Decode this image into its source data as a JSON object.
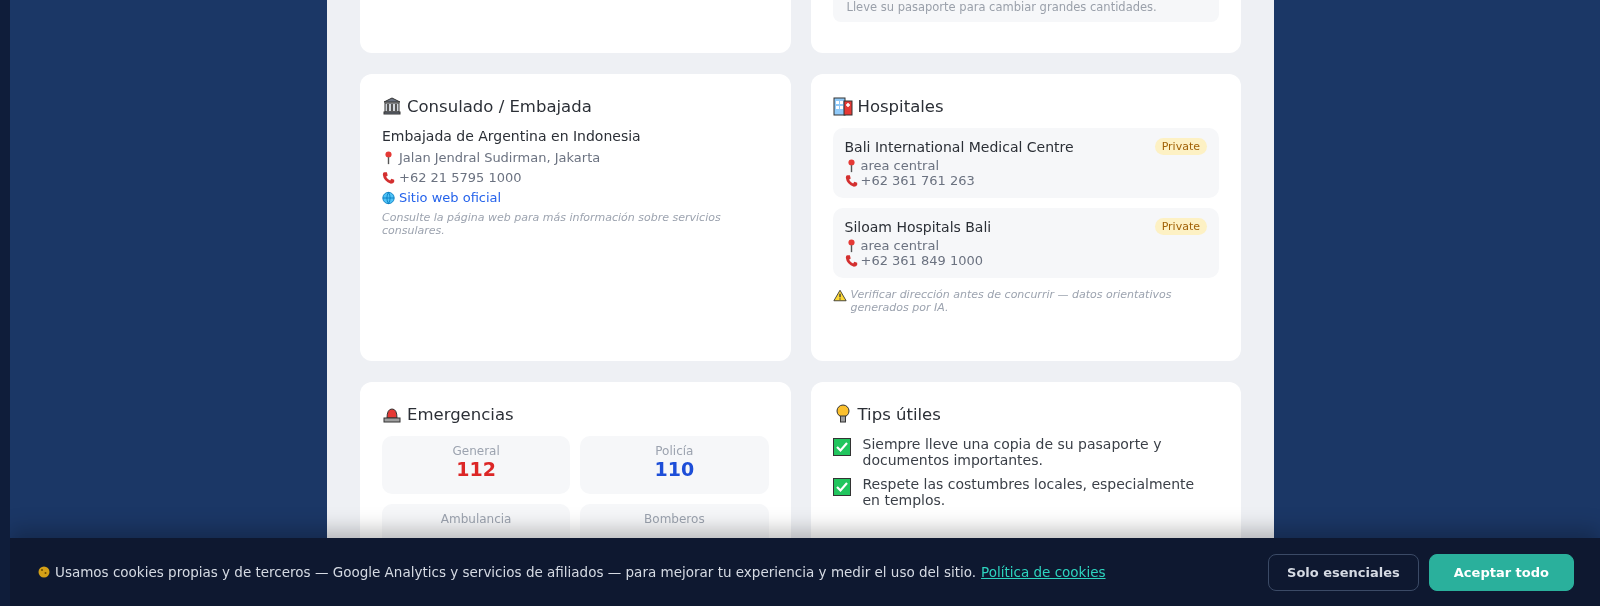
{
  "top_note": "Lleve su pasaporte para cambiar grandes cantidades.",
  "consulate": {
    "title": "Consulado / Embajada",
    "name": "Embajada de Argentina en Indonesia",
    "address": "Jalan Jendral Sudirman, Jakarta",
    "phone": "+62 21 5795 1000",
    "link": "Sitio web oficial",
    "note": "Consulte la página web para más información sobre servicios consulares."
  },
  "hospitals": {
    "title": "Hospitales",
    "items": [
      {
        "name": "Bali International Medical Centre",
        "badge": "Private",
        "area": "area central",
        "phone": "+62 361 761 263"
      },
      {
        "name": "Siloam Hospitals Bali",
        "badge": "Private",
        "area": "area central",
        "phone": "+62 361 849 1000"
      }
    ],
    "warning": "Verificar dirección antes de concurrir — datos orientativos generados por IA."
  },
  "emergencies": {
    "title": "Emergencias",
    "items": [
      {
        "label": "General",
        "number": "112",
        "color": "#dc2626"
      },
      {
        "label": "Policía",
        "number": "110",
        "color": "#1d4ed8"
      },
      {
        "label": "Ambulancia"
      },
      {
        "label": "Bomberos"
      }
    ]
  },
  "tips": {
    "title": "Tips útiles",
    "items": [
      {
        "text": "Siempre lleve una copia de su pasaporte y documentos importantes.",
        "checked": true
      },
      {
        "text": "Respete las costumbres locales, especialmente en templos.",
        "checked": true
      }
    ]
  },
  "cookie_bar": {
    "text": "Usamos cookies propias y de terceros — Google Analytics y servicios de afiliados — para mejorar tu experiencia y medir el uso del sitio.",
    "link": "Política de cookies",
    "buttons": [
      "Solo esenciales",
      "Aceptar todo"
    ]
  }
}
